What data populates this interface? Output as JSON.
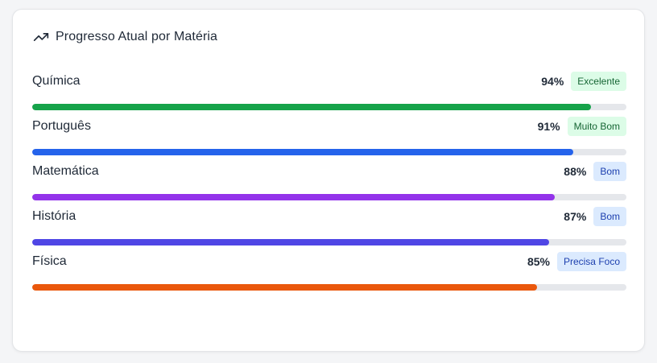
{
  "card": {
    "title": "Progresso Atual por Matéria",
    "icon": "trending-up-icon"
  },
  "subjects": [
    {
      "name": "Química",
      "percent_label": "94%",
      "progress": 0.94,
      "badge": "Excelente",
      "badge_style": "green",
      "color": "#16a34a"
    },
    {
      "name": "Português",
      "percent_label": "91%",
      "progress": 0.91,
      "badge": "Muito Bom",
      "badge_style": "green",
      "color": "#2563eb"
    },
    {
      "name": "Matemática",
      "percent_label": "88%",
      "progress": 0.88,
      "badge": "Bom",
      "badge_style": "blue",
      "color": "#9333ea"
    },
    {
      "name": "História",
      "percent_label": "87%",
      "progress": 0.87,
      "badge": "Bom",
      "badge_style": "blue",
      "color": "#4f46e5"
    },
    {
      "name": "Física",
      "percent_label": "85%",
      "progress": 0.85,
      "badge": "Precisa Foco",
      "badge_style": "blue",
      "color": "#ea580c"
    }
  ],
  "colors": {
    "track": "#e5e7eb",
    "badge_green_bg": "#dcfce7",
    "badge_green_text": "#166534",
    "badge_blue_bg": "#dbeafe",
    "badge_blue_text": "#1e40af"
  }
}
